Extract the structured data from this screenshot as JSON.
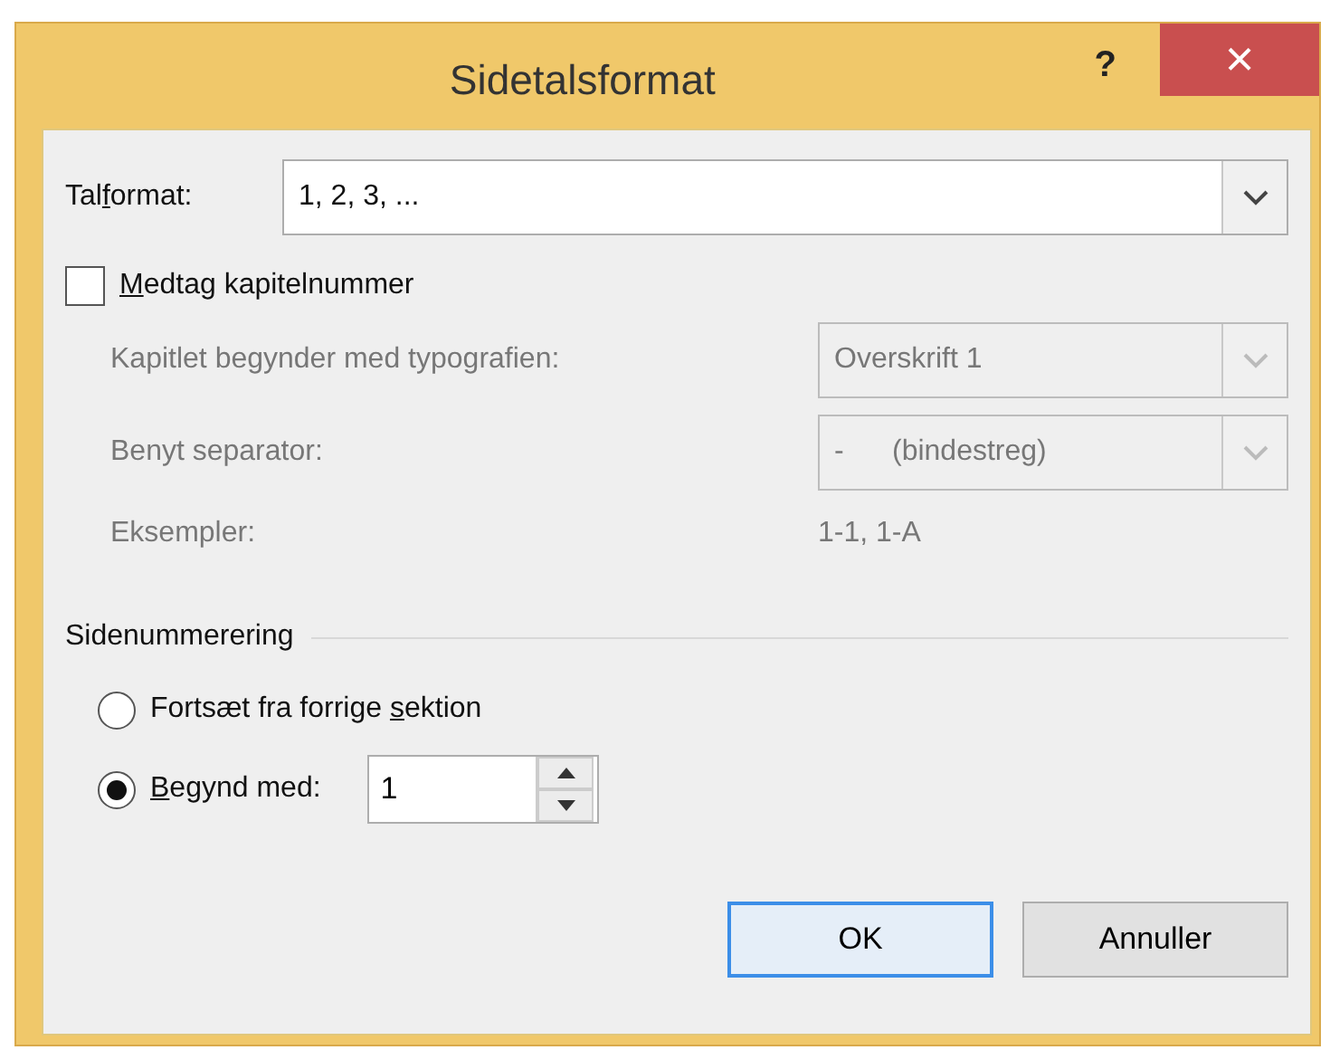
{
  "window": {
    "title": "Sidetalsformat",
    "help": "?",
    "close": "×"
  },
  "number_format": {
    "label": {
      "before": "Tal",
      "access_key": "f",
      "after": "ormat:"
    },
    "value": "1, 2, 3, ..."
  },
  "include_chapter": {
    "label": {
      "access_key": "M",
      "after": "edtag kapitelnummer"
    },
    "checked": false
  },
  "chapter_fields": [
    {
      "kind": "dropdown",
      "label": "Kapitlet begynder med typografien:",
      "value": "Overskrift 1",
      "disabled": true
    },
    {
      "kind": "dropdown",
      "label": "Benyt separator:",
      "value": "-      (bindestreg)",
      "disabled": true
    },
    {
      "kind": "text",
      "label": "Eksempler:",
      "value": "1-1, 1-A",
      "disabled": true
    }
  ],
  "page_numbering": {
    "title": "Sidenummerering",
    "options": [
      {
        "label": {
          "before": "Fortsæt fra forrige ",
          "access_key": "s",
          "after": "ektion"
        },
        "selected": false
      },
      {
        "label": {
          "access_key": "B",
          "after": "egynd med:"
        },
        "selected": true,
        "value": "1"
      }
    ]
  },
  "buttons": [
    {
      "label": "OK",
      "default": true
    },
    {
      "label": "Annuller",
      "default": false
    }
  ]
}
